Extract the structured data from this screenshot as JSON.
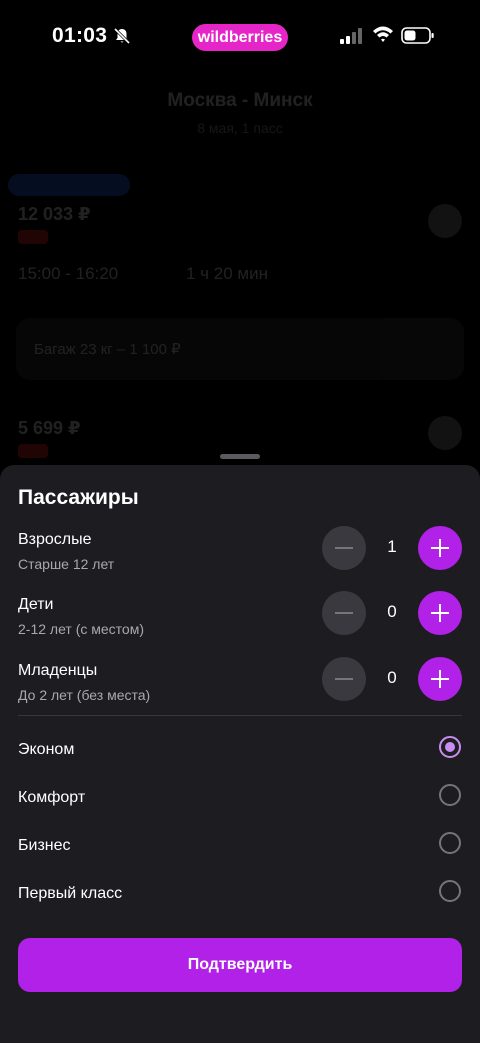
{
  "status_bar": {
    "time": "01:03",
    "brand": "wildberries",
    "brand_color": "#e625c9"
  },
  "background": {
    "route": "Москва - Минск",
    "date": "8 мая, 1 пасс",
    "price_1": "12 033 ₽",
    "times": "15:00 - 16:20",
    "duration": "1 ч 20 мин",
    "baggage": "Багаж 23 кг – 1 100 ₽",
    "price_2": "5 699 ₽"
  },
  "sheet": {
    "title": "Пассажиры",
    "passengers": [
      {
        "label": "Взрослые",
        "sub": "Старше 12 лет",
        "count": "1"
      },
      {
        "label": "Дети",
        "sub": "2-12 лет (с местом)",
        "count": "0"
      },
      {
        "label": "Младенцы",
        "sub": "До 2 лет (без места)",
        "count": "0"
      }
    ],
    "classes": [
      {
        "label": "Эконом",
        "selected": true
      },
      {
        "label": "Комфорт",
        "selected": false
      },
      {
        "label": "Бизнес",
        "selected": false
      },
      {
        "label": "Первый класс",
        "selected": false
      }
    ],
    "confirm_label": "Подтвердить",
    "accent_color": "#b221e8"
  }
}
